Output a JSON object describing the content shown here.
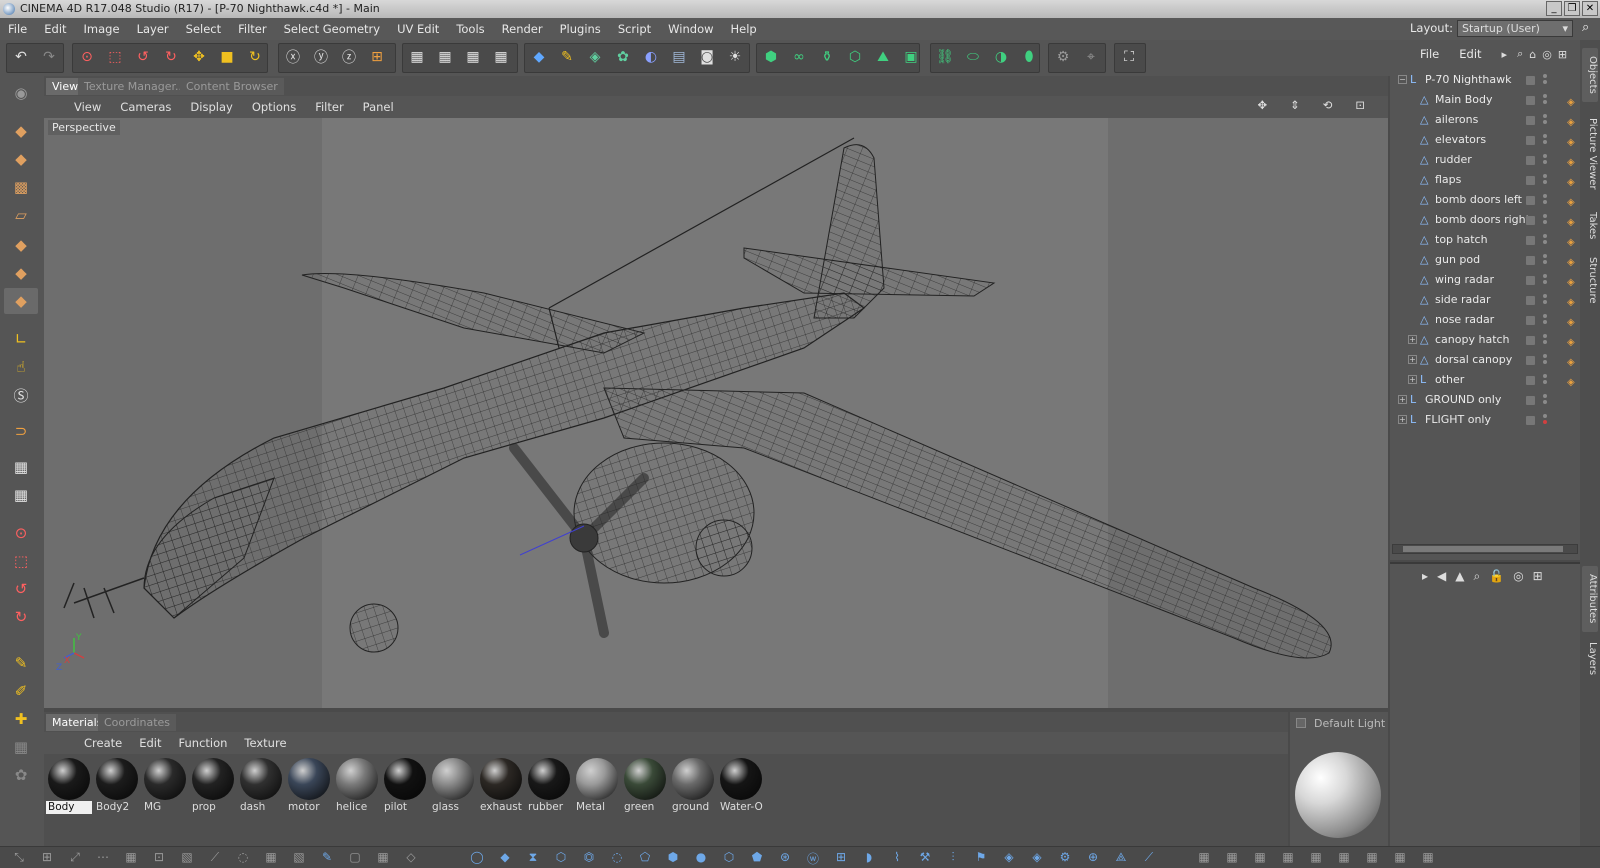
{
  "window": {
    "title": "CINEMA 4D R17.048 Studio (R17) - [P-70 Nighthawk.c4d *] - Main",
    "controls": [
      "_",
      "❐",
      "✕"
    ]
  },
  "menubar": {
    "items": [
      "File",
      "Edit",
      "Image",
      "Layer",
      "Select",
      "Filter",
      "Select Geometry",
      "UV Edit",
      "Tools",
      "Render",
      "Plugins",
      "Script",
      "Window",
      "Help"
    ],
    "layout_label": "Layout:",
    "layout_value": "Startup (User)"
  },
  "viewport": {
    "tabs": [
      "View",
      "Texture Manager...",
      "Content Browser"
    ],
    "active_tab": "View",
    "menu": [
      "View",
      "Cameras",
      "Display",
      "Options",
      "Filter",
      "Panel"
    ],
    "label": "Perspective",
    "axis_labels": [
      "Y",
      "X",
      "Z"
    ]
  },
  "object_manager": {
    "menu": [
      "File",
      "Edit"
    ],
    "objects": [
      {
        "name": "P-70 Nighthawk",
        "level": 0,
        "expander": "−",
        "type": "null"
      },
      {
        "name": "Main Body",
        "level": 1,
        "expander": "",
        "type": "poly"
      },
      {
        "name": "ailerons",
        "level": 1,
        "expander": "",
        "type": "poly"
      },
      {
        "name": "elevators",
        "level": 1,
        "expander": "",
        "type": "poly"
      },
      {
        "name": "rudder",
        "level": 1,
        "expander": "",
        "type": "poly"
      },
      {
        "name": "flaps",
        "level": 1,
        "expander": "",
        "type": "poly"
      },
      {
        "name": "bomb doors left",
        "level": 1,
        "expander": "",
        "type": "poly"
      },
      {
        "name": "bomb doors right",
        "level": 1,
        "expander": "",
        "type": "poly"
      },
      {
        "name": "top hatch",
        "level": 1,
        "expander": "",
        "type": "poly"
      },
      {
        "name": "gun pod",
        "level": 1,
        "expander": "",
        "type": "poly"
      },
      {
        "name": "wing radar",
        "level": 1,
        "expander": "",
        "type": "poly"
      },
      {
        "name": "side radar",
        "level": 1,
        "expander": "",
        "type": "poly"
      },
      {
        "name": "nose radar",
        "level": 1,
        "expander": "",
        "type": "poly"
      },
      {
        "name": "canopy hatch",
        "level": 1,
        "expander": "+",
        "type": "poly"
      },
      {
        "name": "dorsal canopy",
        "level": 1,
        "expander": "+",
        "type": "poly"
      },
      {
        "name": "other",
        "level": 1,
        "expander": "+",
        "type": "null"
      },
      {
        "name": "GROUND only",
        "level": 0,
        "expander": "+",
        "type": "null"
      },
      {
        "name": "FLIGHT only",
        "level": 0,
        "expander": "+",
        "type": "null"
      }
    ]
  },
  "side_tabs": {
    "top": [
      "Objects",
      "Picture Viewer",
      "Takes",
      "Structure"
    ],
    "bottom": [
      "Attributes",
      "Layers"
    ]
  },
  "materials": {
    "tabs": [
      "Materials",
      "Coordinates"
    ],
    "menu": [
      "Create",
      "Edit",
      "Function",
      "Texture"
    ],
    "items": [
      {
        "name": "Body",
        "color": "#1a1a1a",
        "selected": true
      },
      {
        "name": "Body2",
        "color": "#1c1c1c"
      },
      {
        "name": "MG",
        "color": "#2a2a2a"
      },
      {
        "name": "prop",
        "color": "#222222"
      },
      {
        "name": "dash",
        "color": "#303030"
      },
      {
        "name": "motor",
        "color": "#3a4658"
      },
      {
        "name": "helice",
        "color": "#7a7a7a"
      },
      {
        "name": "pilot",
        "color": "#111111"
      },
      {
        "name": "glass",
        "color": "#8a8a8a"
      },
      {
        "name": "exhaust",
        "color": "#2c2824"
      },
      {
        "name": "rubber",
        "color": "#181818"
      },
      {
        "name": "Metal",
        "color": "#9a9a9a"
      },
      {
        "name": "green",
        "color": "#3a4a38"
      },
      {
        "name": "ground",
        "color": "#6a6a6a"
      },
      {
        "name": "Water-O",
        "color": "#151515"
      }
    ]
  },
  "material_preview": {
    "label": "Default Light"
  },
  "colors": {
    "accent": "#e8a040",
    "viewport_bg": "#787878",
    "panel_bg": "#555555"
  }
}
